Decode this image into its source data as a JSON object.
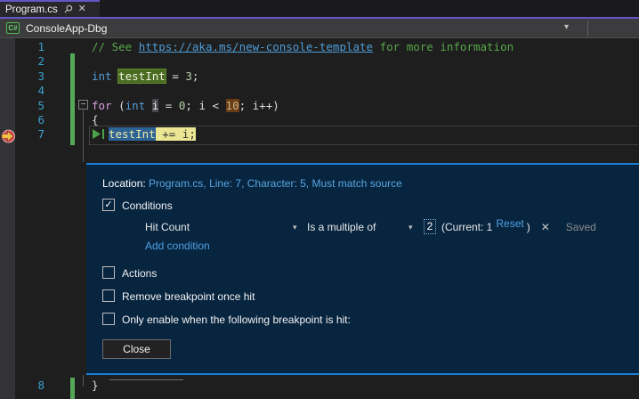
{
  "tab": {
    "title": "Program.cs"
  },
  "navbar": {
    "project": "ConsoleApp-Dbg",
    "csharp_badge": "C#"
  },
  "icons": {
    "pin": "⚲",
    "close": "✕",
    "dropdown": "▾",
    "check": "✓",
    "collapse": "−",
    "remove": "✕"
  },
  "editor": {
    "line_numbers": [
      "1",
      "2",
      "3",
      "4",
      "5",
      "6",
      "7",
      "8"
    ],
    "lines": [
      {
        "segments": [
          {
            "text": "// See "
          },
          {
            "text": "https://aka.ms/new-console-template"
          },
          {
            "text": " for more information"
          }
        ]
      },
      {
        "segments": [
          {
            "text": ""
          }
        ]
      },
      {
        "segments": [
          {
            "text": "int"
          },
          {
            "text": " "
          },
          {
            "text": "testInt"
          },
          {
            "text": " = "
          },
          {
            "text": "3"
          },
          {
            "text": ";"
          }
        ]
      },
      {
        "segments": [
          {
            "text": ""
          }
        ]
      },
      {
        "segments": [
          {
            "text": "for"
          },
          {
            "text": " ("
          },
          {
            "text": "int"
          },
          {
            "text": " "
          },
          {
            "text": "i"
          },
          {
            "text": " = "
          },
          {
            "text": "0"
          },
          {
            "text": "; i < "
          },
          {
            "text": "10"
          },
          {
            "text": "; i++)"
          }
        ]
      },
      {
        "segments": [
          {
            "text": "{"
          }
        ]
      },
      {
        "segments": [
          {
            "text": "testInt"
          },
          {
            "text": " += i;"
          }
        ]
      },
      {
        "segments": [
          {
            "text": "}"
          }
        ]
      }
    ]
  },
  "panel": {
    "location_label": "Location:",
    "location_value": "Program.cs, Line: 7, Character: 5, Must match source",
    "conditions_label": "Conditions",
    "hit_count_dropdown": "Hit Count",
    "operator_dropdown": "Is a multiple of",
    "hit_value": "2",
    "current_text": "(Current: 1",
    "reset_link": "Reset",
    "close_paren": ")",
    "saved_text": "Saved",
    "add_condition_link": "Add condition",
    "actions_label": "Actions",
    "remove_label": "Remove breakpoint once hit",
    "only_enable_label": "Only enable when the following breakpoint is hit:",
    "close_button": "Close"
  },
  "colors": {
    "accent_purple": "#6256C8",
    "panel_border_blue": "#1B7FD4",
    "panel_bg": "#082540",
    "editor_bg": "#1E1E1E",
    "change_bar_green": "#55A857",
    "current_statement_yellow": "#EAE693",
    "selection_blue": "#2D6295",
    "breakpoint_red": "#D6494F",
    "arrow_yellow": "#F2C249"
  }
}
